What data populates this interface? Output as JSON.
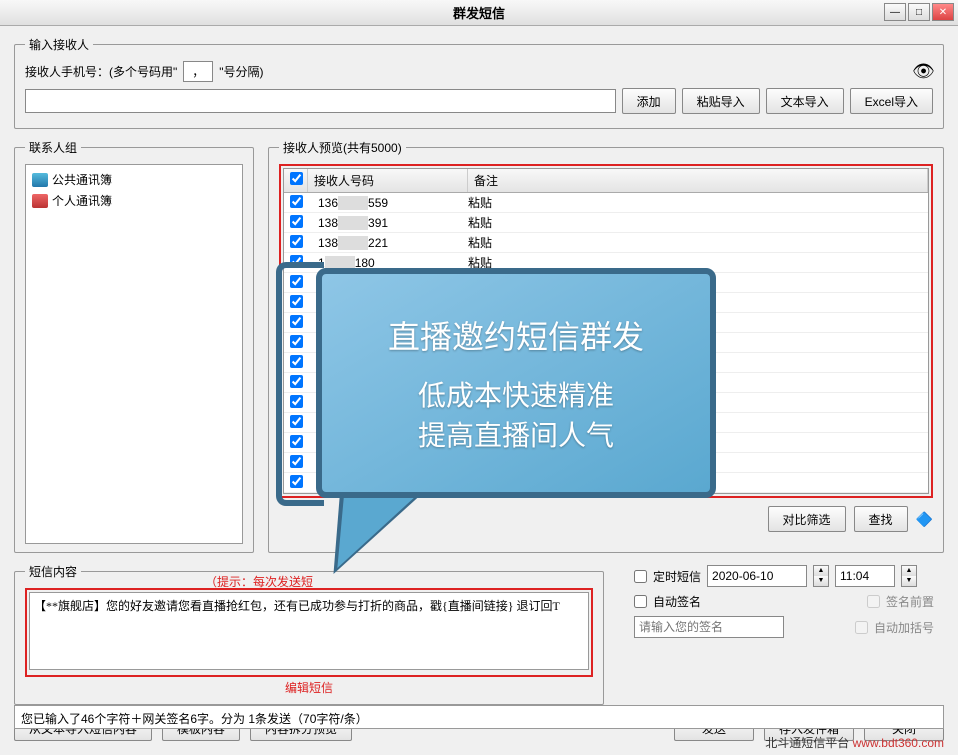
{
  "window": {
    "title": "群发短信"
  },
  "recipient_input": {
    "legend": "输入接收人",
    "label_prefix": "接收人手机号：(多个号码用\"",
    "separator": "，",
    "label_suffix": "\"号分隔)",
    "add": "添加",
    "paste_import": "粘贴导入",
    "text_import": "文本导入",
    "excel_import": "Excel导入"
  },
  "contact_groups": {
    "legend": "联系人组",
    "items": [
      {
        "label": "公共通讯簿",
        "icon": "blue"
      },
      {
        "label": "个人通讯簿",
        "icon": "red"
      }
    ]
  },
  "preview": {
    "legend": "接收人预览(共有5000)",
    "col_number": "接收人号码",
    "col_note": "备注",
    "rows": [
      {
        "prefix": "136",
        "suffix": "559",
        "note": "粘贴"
      },
      {
        "prefix": "138",
        "suffix": "391",
        "note": "粘贴"
      },
      {
        "prefix": "138",
        "suffix": "221",
        "note": "粘贴"
      },
      {
        "prefix": "1",
        "suffix": "180",
        "note": "粘贴"
      }
    ],
    "compare_filter": "对比筛选",
    "find": "查找"
  },
  "message": {
    "legend": "短信内容",
    "hint": "（提示：每次发送短",
    "text": "【**旗舰店】您的好友邀请您看直播抢红包，还有已成功参与打折的商品，戳{直播间链接} 退订回T",
    "edit_label": "编辑短信"
  },
  "options": {
    "scheduled": "定时短信",
    "date": "2020-06-10",
    "time": "11:04",
    "auto_sign": "自动签名",
    "sign_front": "签名前置",
    "sign_placeholder": "请输入您的签名",
    "auto_bracket": "自动加括号"
  },
  "bottom": {
    "import_text": "从文本导入短信内容",
    "template": "模板内容",
    "split_preview": "内容拆分预览",
    "send": "发送",
    "save_outbox": "存入发件箱",
    "close": "关闭"
  },
  "status": "您已输入了46个字符＋网关签名6字。分为 1条发送（70字符/条）",
  "footer": {
    "text": "北斗通短信平台 ",
    "link": "www.bdt360.com"
  },
  "overlay": {
    "line1": "直播邀约短信群发",
    "line2a": "低成本快速精准",
    "line2b": "提高直播间人气"
  }
}
